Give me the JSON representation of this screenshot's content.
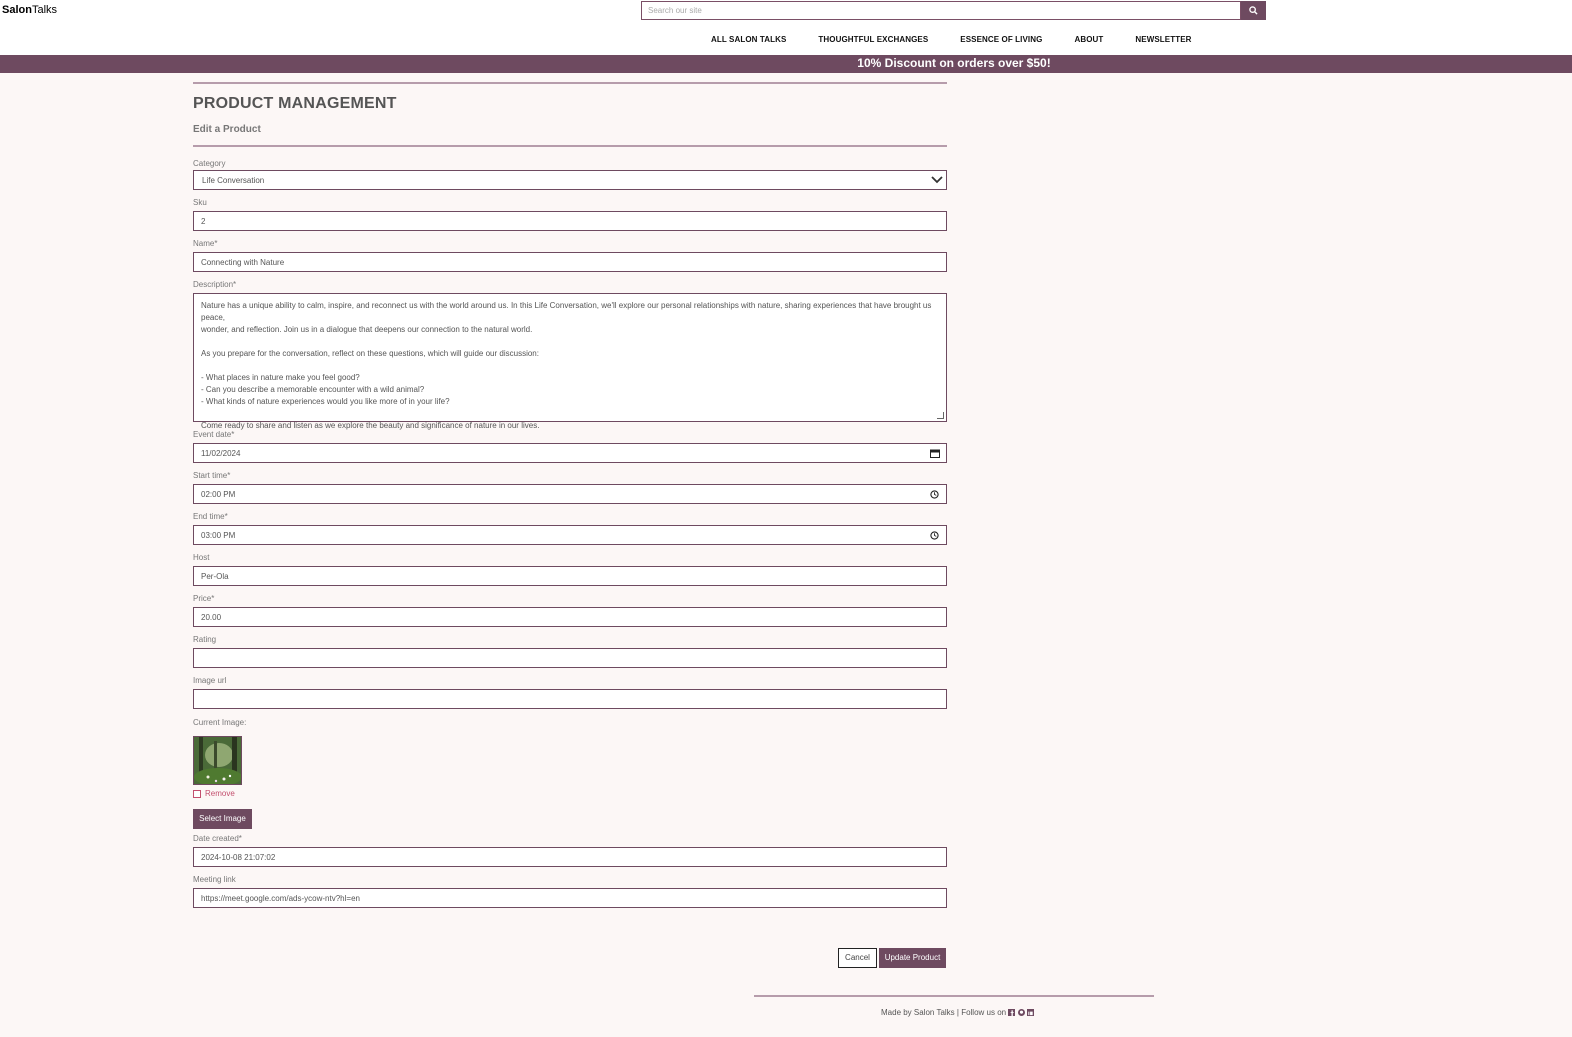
{
  "header": {
    "logo_bold": "Salon",
    "logo_rest": "Talks",
    "search_placeholder": "Search our site",
    "search_icon": "search-icon",
    "nav": [
      "ALL SALON TALKS",
      "THOUGHTFUL EXCHANGES",
      "ESSENCE OF LIVING",
      "ABOUT",
      "NEWSLETTER"
    ]
  },
  "banner": "10% Discount on orders over $50!",
  "page": {
    "title": "PRODUCT MANAGEMENT",
    "subtitle": "Edit a Product"
  },
  "form": {
    "category": {
      "label": "Category",
      "value": "Life Conversation"
    },
    "sku": {
      "label": "Sku",
      "value": "2"
    },
    "name": {
      "label": "Name*",
      "value": "Connecting with Nature"
    },
    "description": {
      "label": "Description*",
      "value": "Nature has a unique ability to calm, inspire, and reconnect us with the world around us. In this Life Conversation, we'll explore our personal relationships with nature, sharing experiences that have brought us peace,\nwonder, and reflection. Join us in a dialogue that deepens our connection to the natural world.\n\nAs you prepare for the conversation, reflect on these questions, which will guide our discussion:\n\n- What places in nature make you feel good?\n- Can you describe a memorable encounter with a wild animal?\n- What kinds of nature experiences would you like more of in your life?\n\nCome ready to share and listen as we explore the beauty and significance of nature in our lives."
    },
    "event_date": {
      "label": "Event date*",
      "value": "11/02/2024"
    },
    "start_time": {
      "label": "Start time*",
      "value": "02:00 PM"
    },
    "end_time": {
      "label": "End time*",
      "value": "03:00 PM"
    },
    "host": {
      "label": "Host",
      "value": "Per-Ola"
    },
    "price": {
      "label": "Price*",
      "value": "20.00"
    },
    "rating": {
      "label": "Rating",
      "value": ""
    },
    "image_url": {
      "label": "Image url",
      "value": ""
    },
    "current_image_label": "Current Image:",
    "remove_label": "Remove",
    "select_image_label": "Select Image",
    "date_created": {
      "label": "Date created*",
      "value": "2024-10-08 21:07:02"
    },
    "meeting_link": {
      "label": "Meeting link",
      "value": "https://meet.google.com/ads-ycow-ntv?hl=en"
    },
    "cancel_label": "Cancel",
    "update_label": "Update Product"
  },
  "footer": {
    "text": "Made by Salon Talks | Follow us on",
    "icons": [
      "facebook-icon",
      "github-icon",
      "linkedin-icon"
    ]
  },
  "colors": {
    "accent": "#6e4a60",
    "background": "#fcf7f6",
    "remove": "#c34f6e"
  }
}
